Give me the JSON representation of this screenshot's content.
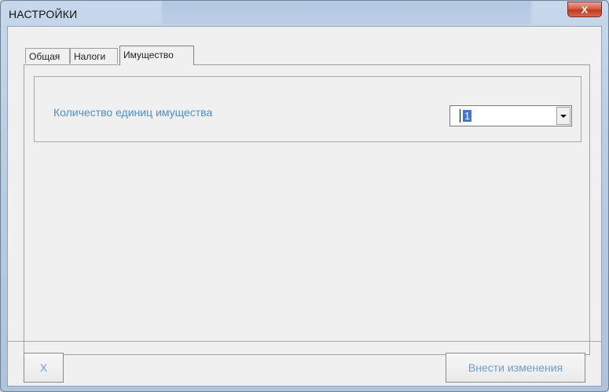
{
  "window": {
    "title": "НАСТРОЙКИ",
    "close_label": "X"
  },
  "tabs": [
    {
      "label": "Общая",
      "active": false
    },
    {
      "label": "Налоги",
      "active": false
    },
    {
      "label": "Имущество",
      "active": true
    }
  ],
  "property": {
    "quantity_label": "Количество единиц имущества",
    "quantity_value": "1"
  },
  "buttons": {
    "cancel_label": "X",
    "apply_label": "Внести изменения"
  },
  "colors": {
    "label_blue": "#4a8fd6",
    "button_text_blue": "#6a9fd8",
    "close_red": "#d65a45"
  }
}
